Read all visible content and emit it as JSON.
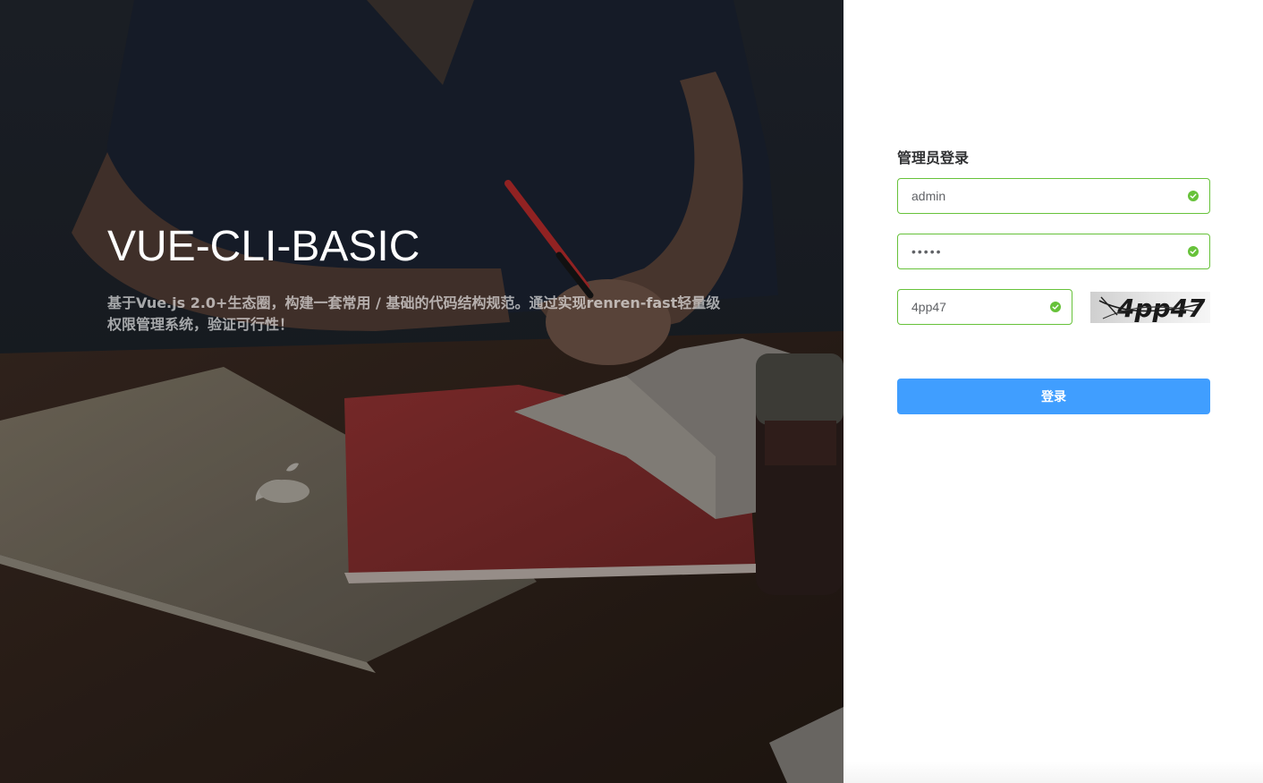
{
  "hero": {
    "title": "VUE-CLI-BASIC",
    "description": "基于Vue.js 2.0+生态圈，构建一套常用 / 基础的代码结构规范。通过实现renren-fast轻量级权限管理系统，验证可行性！"
  },
  "login": {
    "title": "管理员登录",
    "username_value": "admin",
    "password_value": "•••••",
    "captcha_value": "4pp47",
    "captcha_image_text": "4pp47",
    "submit_label": "登录",
    "valid_color": "#67c23a",
    "button_color": "#409eff"
  }
}
